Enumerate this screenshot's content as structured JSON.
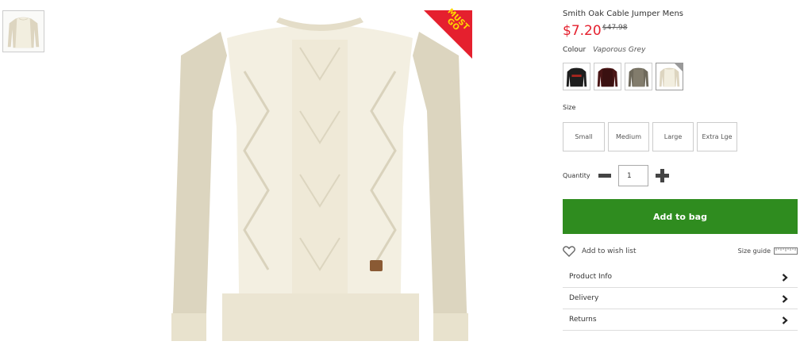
{
  "product": {
    "name": "Smith Oak Cable Jumper Mens",
    "price": "$7.20",
    "was_price": "$47.98",
    "badge_line1": "MUST",
    "badge_line2": "GO"
  },
  "colour": {
    "label": "Colour",
    "selected": "Vaporous Grey",
    "swatches": [
      {
        "name": "black",
        "color": "#1e1e1e"
      },
      {
        "name": "burgundy",
        "color": "#4a1616"
      },
      {
        "name": "olive-grey",
        "color": "#6f6a5c"
      },
      {
        "name": "vaporous-grey",
        "color": "#e9e4d2"
      }
    ]
  },
  "size": {
    "heading": "Size",
    "options": [
      "Small",
      "Medium",
      "Large",
      "Extra Lge"
    ]
  },
  "quantity": {
    "label": "Quantity",
    "value": "1"
  },
  "actions": {
    "add_to_bag": "Add to bag",
    "wish_list": "Add to wish list",
    "size_guide": "Size guide"
  },
  "info_sections": [
    "Product Info",
    "Delivery",
    "Returns"
  ],
  "colors": {
    "price_red": "#e5202e",
    "add_to_bag_green": "#2f8c1f",
    "badge_red": "#e5202e",
    "badge_text": "#ffd800"
  },
  "icons": {
    "wish": "heart-outline-icon",
    "size_guide": "ruler-icon",
    "info_chevron": "chevron-right-icon",
    "qty_minus": "minus-icon",
    "qty_plus": "plus-icon"
  }
}
